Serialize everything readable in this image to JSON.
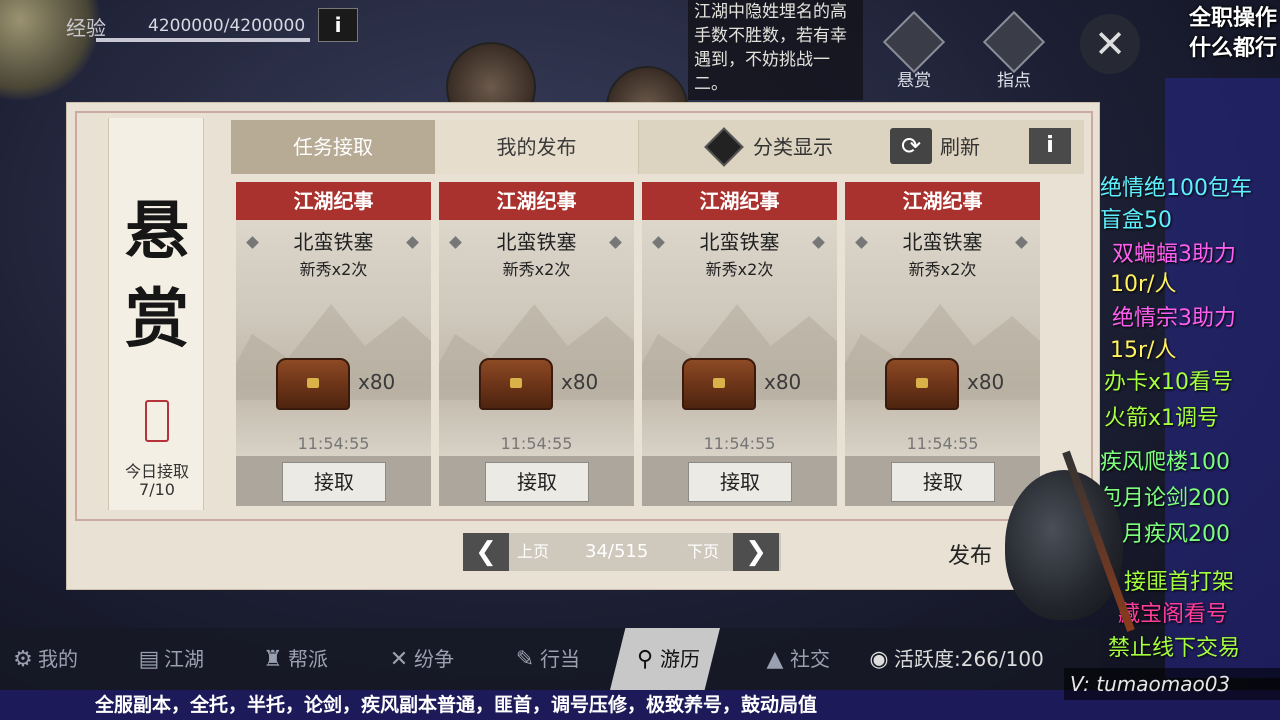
{
  "hud": {
    "exp_label": "经验",
    "exp_value": "4200000/4200000",
    "exp_progress": 1.0,
    "info_glyph": "i",
    "notice": "江湖中隐姓埋名的高手数不胜数，若有幸遇到，不妨挑战一二。",
    "bounty_label": "悬赏",
    "guide_label": "指点",
    "close_glyph": "✕"
  },
  "panel": {
    "scroll_title": "悬赏",
    "seal_text": "悬赏",
    "today_label": "今日接取",
    "today_count": "7/10",
    "tabs": {
      "accept": "任务接取",
      "mine": "我的发布",
      "category": "分类显示",
      "refresh": "刷新",
      "info": "i",
      "refresh_glyph": "⟳"
    },
    "cards": [
      {
        "header": "江湖纪事",
        "name": "北蛮铁塞",
        "sub": "新秀x2次",
        "qty": "x80",
        "time": "11:54:55",
        "button": "接取"
      },
      {
        "header": "江湖纪事",
        "name": "北蛮铁塞",
        "sub": "新秀x2次",
        "qty": "x80",
        "time": "11:54:55",
        "button": "接取"
      },
      {
        "header": "江湖纪事",
        "name": "北蛮铁塞",
        "sub": "新秀x2次",
        "qty": "x80",
        "time": "11:54:55",
        "button": "接取"
      },
      {
        "header": "江湖纪事",
        "name": "北蛮铁塞",
        "sub": "新秀x2次",
        "qty": "x80",
        "time": "11:54:55",
        "button": "接取"
      }
    ],
    "pager": {
      "prev_glyph": "❮",
      "next_glyph": "❯",
      "prev_label": "上页",
      "count": "34/515",
      "next_label": "下页"
    },
    "publish": "发布"
  },
  "nav": {
    "items": [
      {
        "label": "我的",
        "icon": "⚙"
      },
      {
        "label": "江湖",
        "icon": "▤"
      },
      {
        "label": "帮派",
        "icon": "♜"
      },
      {
        "label": "纷争",
        "icon": "✕"
      },
      {
        "label": "行当",
        "icon": "✎"
      },
      {
        "label": "游历",
        "icon": "⚲"
      },
      {
        "label": "社交",
        "icon": "▲"
      }
    ],
    "activity": "活跃度:266/100",
    "activity_icon": "◉"
  },
  "overlay": {
    "top_line1": "全职操作",
    "top_line2": "什么都行",
    "lines": [
      {
        "text": "绝情绝100包车",
        "color": "#5ff0ff"
      },
      {
        "text": "盲盒50",
        "color": "#5ff0ff"
      },
      {
        "text": "双蝙蝠3助力",
        "color": "#ff5ff0"
      },
      {
        "text": "10r/人",
        "color": "#fff15f"
      },
      {
        "text": "绝情宗3助力",
        "color": "#ff5ff0"
      },
      {
        "text": "15r/人",
        "color": "#fff15f"
      },
      {
        "text": "办卡x10看号",
        "color": "#a6ff3d"
      },
      {
        "text": "火箭x1调号",
        "color": "#a6ff3d"
      },
      {
        "text": "疾风爬楼100",
        "color": "#7dff7d"
      },
      {
        "text": "包月论剑200",
        "color": "#7dff7d"
      },
      {
        "text": "包月疾风200",
        "color": "#7dff7d"
      },
      {
        "text": "接匪首打架",
        "color": "#a6ff3d"
      },
      {
        "text": "藏宝阁看号",
        "color": "#ff3d9a"
      },
      {
        "text": "禁止线下交易",
        "color": "#a6ff3d"
      }
    ],
    "marquee": "全服副本，全托，半托，论剑，疾风副本普通，匪首，调号压修，极致养号，鼓动局值",
    "watermark": "V: tumaomao03"
  }
}
